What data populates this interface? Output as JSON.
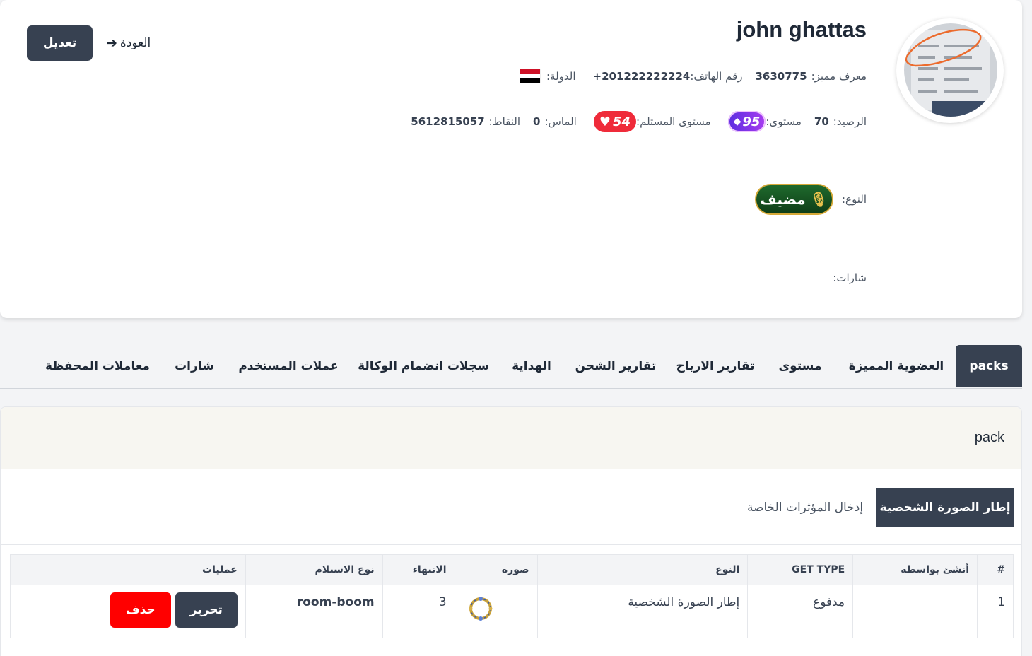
{
  "profile": {
    "name": "john ghattas",
    "back_label": "العودة",
    "edit_label": "تعديل",
    "special_id_label": "معرف مميز:",
    "special_id_value": "3630775",
    "phone_label": "رقم الهاتف:",
    "phone_value": "+201222222224",
    "country_label": "الدولة:",
    "country_flag": "egypt-flag",
    "balance_label": "الرصيد:",
    "balance_value": "70",
    "level_label": "مستوى:",
    "level_value": "95",
    "receiver_level_label": "مستوى المستلم:",
    "receiver_level_value": "54",
    "diamond_label": "الماس:",
    "diamond_value": "0",
    "points_label": "النقاط:",
    "points_value": "5612815057",
    "type_label": "النوع:",
    "type_value": "مضيف",
    "badges_label": "شارات:"
  },
  "tabs": [
    {
      "label": "packs",
      "active": true
    },
    {
      "label": "العضوية المميزة",
      "active": false
    },
    {
      "label": "مستوى",
      "active": false
    },
    {
      "label": "تقارير الارباح",
      "active": false
    },
    {
      "label": "تقارير الشحن",
      "active": false
    },
    {
      "label": "الهداية",
      "active": false
    },
    {
      "label": "سجلات انضمام الوكالة",
      "active": false
    },
    {
      "label": "عملات المستخدم",
      "active": false
    },
    {
      "label": "شارات",
      "active": false
    },
    {
      "label": "معاملات المحفظة",
      "active": false
    }
  ],
  "pack": {
    "title": "pack",
    "subtabs": [
      {
        "label": "إطار الصورة الشخصية",
        "active": true
      },
      {
        "label": "إدخال المؤثرات الخاصة",
        "active": false
      }
    ],
    "table": {
      "headers": [
        "#",
        "أنشئ بواسطة",
        "GET TYPE",
        "النوع",
        "صورة",
        "الانتهاء",
        "نوع الاستلام",
        "عمليات"
      ],
      "rows": [
        {
          "index": "1",
          "created_by": "",
          "get_type": "مدفوع",
          "type": "إطار الصورة الشخصية",
          "image": "frame-image",
          "expiry": "3",
          "receive_type": "room-boom",
          "edit_label": "تحرير",
          "delete_label": "حذف"
        }
      ]
    }
  },
  "colors": {
    "dark": "#374151",
    "danger": "#ff0000",
    "level_badge": "#7c3aed",
    "heart_badge": "#ef2b3a"
  }
}
